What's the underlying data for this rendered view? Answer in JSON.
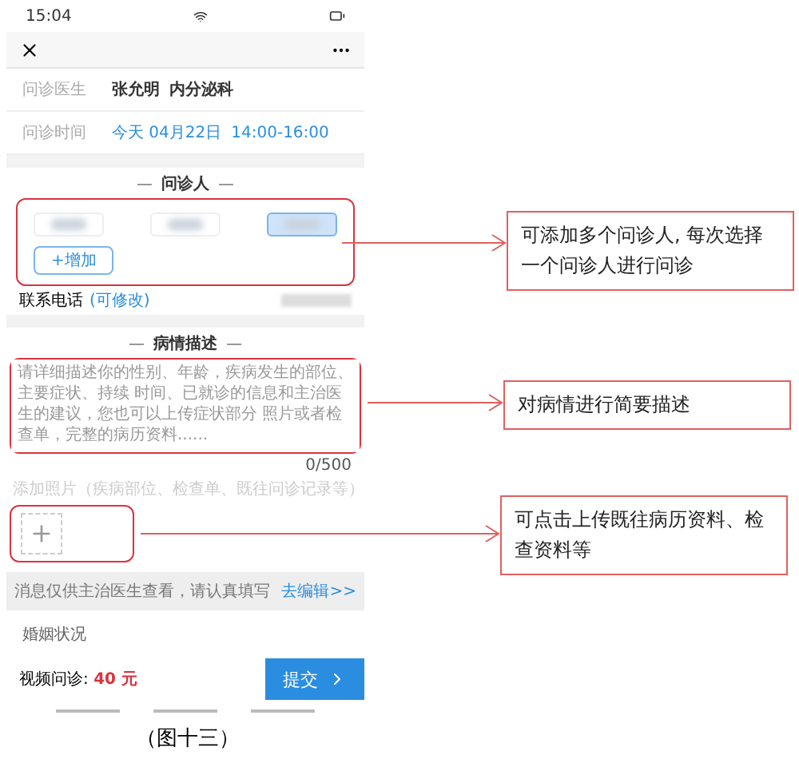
{
  "status_bar": {
    "time": "15:04"
  },
  "info_rows": [
    {
      "label": "问诊医生",
      "kind": "plain",
      "values": [
        "张允明",
        "内分泌科"
      ]
    },
    {
      "label": "问诊时间",
      "kind": "link",
      "values": [
        "今天 04月22日",
        "14:00-16:00"
      ]
    }
  ],
  "patients": {
    "title": "问诊人",
    "chips": [
      {
        "selected": false
      },
      {
        "selected": false
      },
      {
        "selected": true
      }
    ],
    "add_button": "+增加"
  },
  "phone": {
    "label": "联系电话",
    "edit_hint": "(可修改)"
  },
  "description": {
    "title": "病情描述",
    "placeholder": "请详细描述你的性别、年龄，疾病发生的部位、主要症状、持续 时间、已就诊的信息和主治医生的建议，您也可以上传症状部分 照片或者检查单，完整的病历资料......",
    "counter": "0/500",
    "photo_hint": "添加照片（疾病部位、检查单、既往问诊记录等）"
  },
  "notice": {
    "text": "消息仅供主治医生查看，请认真填写",
    "link": "去编辑>>"
  },
  "extra_rows": [
    "婚姻状况"
  ],
  "footer": {
    "price_label": "视频问诊:",
    "price": "40 元",
    "submit": "提交"
  },
  "annotations": [
    {
      "text": "可添加多个问诊人, 每次选择一个问诊人进行问诊"
    },
    {
      "text": "对病情进行简要描述"
    },
    {
      "text": "可点击上传既往病历资料、检查资料等"
    }
  ],
  "caption": "（图十三）"
}
